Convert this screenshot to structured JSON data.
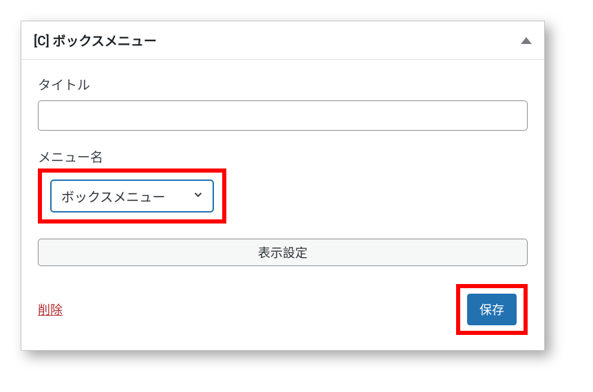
{
  "widget": {
    "header_title": "[C] ボックスメニュー",
    "fields": {
      "title_label": "タイトル",
      "title_value": "",
      "menu_name_label": "メニュー名",
      "menu_selected": "ボックスメニュー"
    },
    "buttons": {
      "display_settings": "表示設定",
      "delete": "削除",
      "save": "保存"
    }
  }
}
